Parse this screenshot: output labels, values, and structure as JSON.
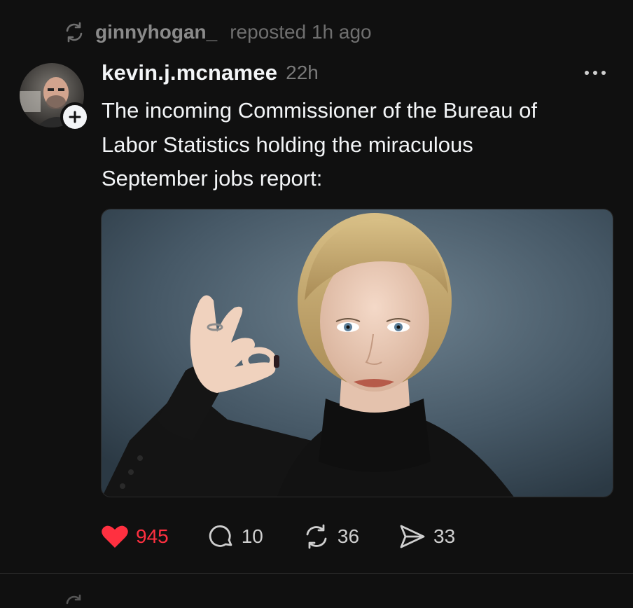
{
  "repost": {
    "icon": "repost-icon",
    "user": "ginnyhogan_",
    "text": "reposted 1h ago"
  },
  "post": {
    "author": "kevin.j.mcnamee",
    "time": "22h",
    "text_lines": [
      "The incoming Commissioner of the Bureau of",
      "Labor Statistics holding the miraculous",
      "September jobs report:"
    ],
    "image": "photo of a blonde woman in a black turtleneck holding a tiny vial between thumb and finger against a dark blue-gray backdrop"
  },
  "actions": {
    "like": {
      "icon": "heart-icon",
      "count": "945",
      "color": "#ff3040"
    },
    "reply": {
      "icon": "comment-icon",
      "count": "10"
    },
    "repost": {
      "icon": "repost-icon",
      "count": "36"
    },
    "share": {
      "icon": "send-icon",
      "count": "33"
    }
  }
}
